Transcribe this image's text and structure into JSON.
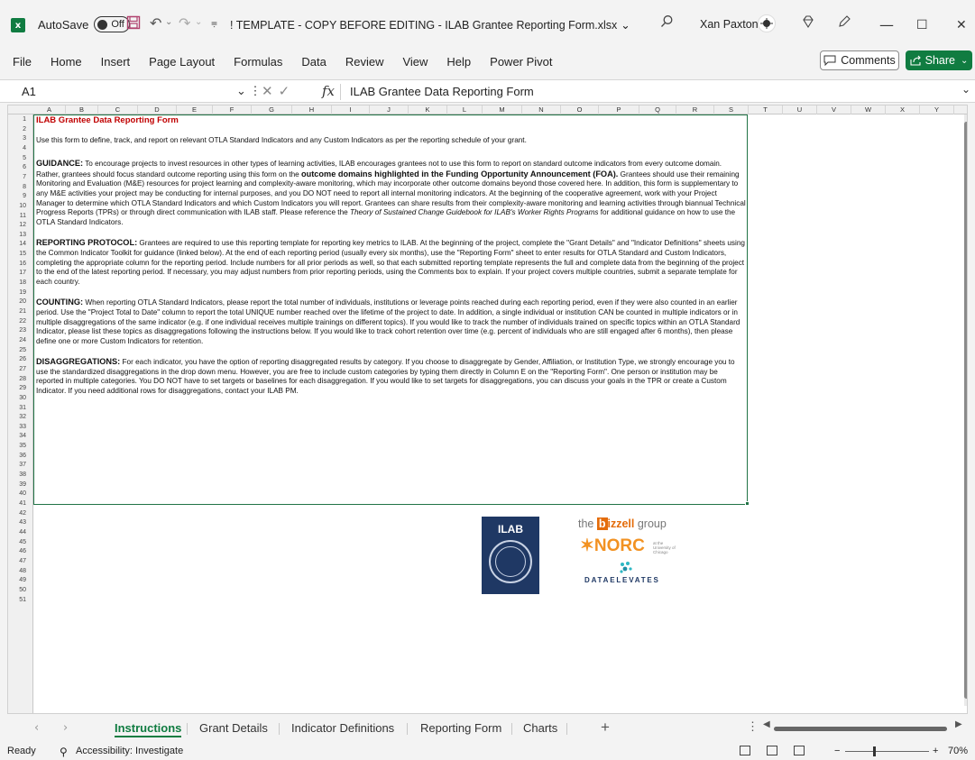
{
  "titlebar": {
    "app_badge": "x",
    "autosave_label": "AutoSave",
    "autosave_state": "Off",
    "filename": "! TEMPLATE - COPY BEFORE EDITING - ILAB Grantee Reporting Form.xlsx",
    "filename_chevron": "⌄",
    "user": "Xan Paxton",
    "minimize": "—",
    "maximize": "☐",
    "close": "✕"
  },
  "menu": [
    "File",
    "Home",
    "Insert",
    "Page Layout",
    "Formulas",
    "Data",
    "Review",
    "View",
    "Help",
    "Power Pivot"
  ],
  "buttons": {
    "comments": "Comments",
    "share": "Share"
  },
  "formula_bar": {
    "cell_ref": "A1",
    "fx": "fx",
    "content": "ILAB Grantee Data Reporting Form"
  },
  "columns": [
    "A",
    "B",
    "C",
    "D",
    "E",
    "F",
    "G",
    "H",
    "I",
    "J",
    "K",
    "L",
    "M",
    "N",
    "O",
    "P",
    "Q",
    "R",
    "S",
    "T",
    "U",
    "V",
    "W",
    "X",
    "Y"
  ],
  "rows": [
    "1",
    "2",
    "3",
    "4",
    "5",
    "6",
    "7",
    "8",
    "9",
    "10",
    "11",
    "12",
    "13",
    "14",
    "15",
    "16",
    "17",
    "18",
    "19",
    "20",
    "21",
    "22",
    "23",
    "24",
    "25",
    "26",
    "27",
    "28",
    "29",
    "30",
    "31",
    "32",
    "33",
    "34",
    "35",
    "36",
    "37",
    "38",
    "39",
    "40",
    "41",
    "42",
    "43",
    "44",
    "45",
    "46",
    "47",
    "48",
    "49",
    "50",
    "51"
  ],
  "document": {
    "title": "ILAB Grantee Data Reporting Form",
    "intro": "Use this form to define, track, and report on relevant OTLA Standard Indicators and any Custom Indicators as per the reporting schedule of your grant.",
    "guidance_head": "GUIDANCE:",
    "guidance_1": " To encourage projects to invest resources in other types of learning activities, ILAB encourages grantees not to use this form to report on standard outcome indicators from every outcome domain. Rather, grantees should focus standard outcome reporting using this form on the ",
    "guidance_bold": "outcome domains highlighted in the Funding Opportunity Announcement (FOA).",
    "guidance_2": " Grantees should use their remaining Monitoring and Evaluation (M&E) resources for project learning and complexity-aware monitoring, which may incorporate other outcome domains beyond those covered here. In addition, this form is supplementary to any M&E activities your project may be conducting for internal purposes, and you DO NOT need to report all internal monitoring indicators. At the beginning of the cooperative agreement, work with your Project Manager to determine which OTLA Standard Indicators and which Custom Indicators you will report. Grantees can share results from their complexity-aware monitoring and learning activities through biannual Technical Progress Reports (TPRs) or through direct communication with ILAB staff. Please reference the ",
    "guidance_italic": "Theory of Sustained Change Guidebook for ILAB's Worker Rights Programs",
    "guidance_3": " for additional guidance on how to use the OTLA Standard Indicators.",
    "protocol_head": "REPORTING PROTOCOL:",
    "protocol_body": " Grantees are required to use this reporting template for reporting key metrics to ILAB. At the beginning of the project, complete the \"Grant Details\" and \"Indicator Definitions\" sheets using the Common Indicator Toolkit for guidance (linked below). At the end of each reporting period (usually every six months), use the \"Reporting Form\" sheet to enter results for OTLA Standard and Custom Indicators, completing the appropriate column for the reporting period. Include numbers for all prior periods as well, so that each submitted reporting template represents the full and complete data from the beginning of the project to the end of the latest reporting period. If necessary, you may adjust numbers from prior reporting periods, using the Comments box to explain. If your project covers multiple countries, submit a separate template for each country.",
    "counting_head": "COUNTING:",
    "counting_body": " When reporting OTLA Standard Indicators, please report the total number of individuals, institutions or leverage points reached during each reporting period, even if they were also counted in an earlier period. Use the \"Project Total to Date\" column to report the total UNIQUE number reached over the lifetime of the project to date. In addition, a single individual or institution CAN be counted in multiple indicators or in multiple disaggregations of the same indicator (e.g. if one individual receives multiple trainings on different topics). If you would like to track the number of individuals trained on specific topics within an OTLA Standard Indicator, please list these topics as disaggregations following the instructions below. If you would like to track cohort retention over time (e.g. percent of individuals who are still engaged after 6 months), then please define one or more Custom Indicators for retention.",
    "disagg_head": "DISAGGREGATIONS:",
    "disagg_body": " For each indicator, you have the option of reporting disaggregated results by category. If you choose to disaggregate by Gender, Affiliation, or Institution Type, we strongly encourage you to use the standardized disaggregations in the drop down menu. However, you are free to include custom categories by typing them directly in Column E on the \"Reporting Form\". One person or institution may be reported in multiple categories. You DO NOT have to set targets or baselines for each disaggregation. If you would like to set targets for disaggregations, you can discuss your goals in the TPR or create a Custom Indicator. If you need additional rows for disaggregations, contact your ILAB PM."
  },
  "logos": {
    "ilab": "ILAB",
    "bizzell_pre": "the ",
    "bizzell_b": "b",
    "bizzell_rest": "izzell",
    "bizzell_post": " group",
    "norc": "✶NORC",
    "norc_sub": "at the University of Chicago",
    "dataelevates": "DATAELEVATES"
  },
  "sheet_tabs": [
    {
      "label": "Instructions",
      "active": true
    },
    {
      "label": "Grant Details",
      "active": false
    },
    {
      "label": "Indicator Definitions",
      "active": false
    },
    {
      "label": "Reporting Form",
      "active": false
    },
    {
      "label": "Charts",
      "active": false
    }
  ],
  "status": {
    "ready": "Ready",
    "accessibility": "Accessibility: Investigate",
    "zoom": "70%"
  },
  "colors": {
    "accent": "#107c41",
    "title_red": "#c00000",
    "ilab_navy": "#1f3864",
    "norc_orange": "#f29222"
  },
  "icons": [
    "excel-icon",
    "save-icon",
    "undo-icon",
    "redo-icon",
    "customize-icon",
    "search-icon",
    "user-avatar-icon",
    "diamond-icon",
    "pen-icon",
    "comment-icon",
    "share-icon",
    "accessibility-icon"
  ]
}
